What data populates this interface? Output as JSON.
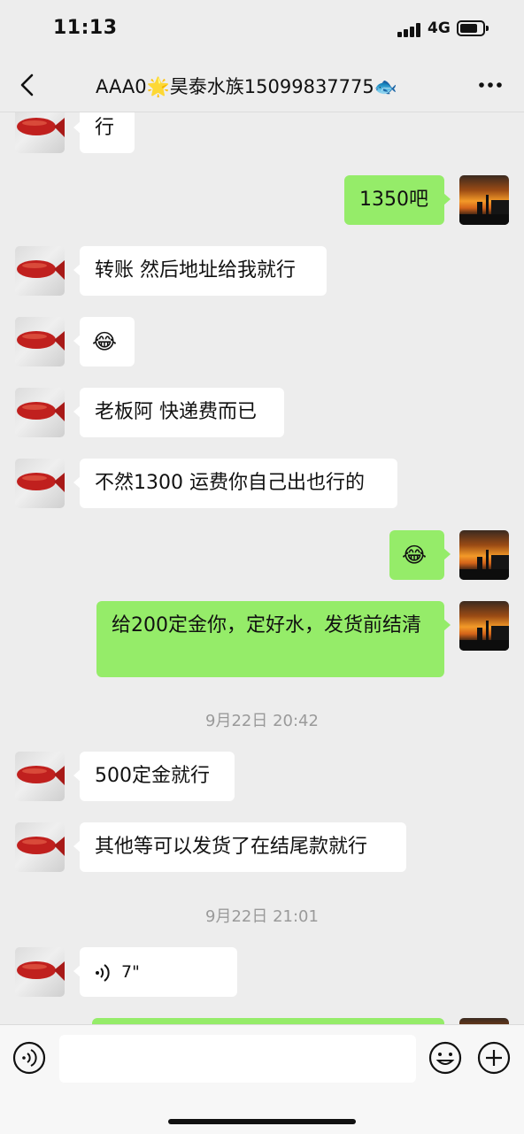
{
  "status": {
    "time": "11:13",
    "network": "4G"
  },
  "nav": {
    "title": "AAA0🌟昊泰水族15099837775🐟"
  },
  "messages": [
    {
      "side": "in",
      "text": "行"
    },
    {
      "side": "out",
      "text": "1350吧"
    },
    {
      "side": "in",
      "text": "转账 然后地址给我就行"
    },
    {
      "side": "in",
      "emoji": "😂"
    },
    {
      "side": "in",
      "text": "老板阿 快递费而已"
    },
    {
      "side": "in",
      "text": "不然1300 运费你自己出也行的"
    },
    {
      "side": "out",
      "emoji": "😂"
    },
    {
      "side": "out",
      "text": "给200定金你，定好水，发货前结清"
    },
    {
      "side": "in",
      "text": "500定金就行"
    },
    {
      "side": "in",
      "text": "其他等可以发货了在结尾款就行"
    },
    {
      "side": "in",
      "voice_duration": "7\""
    },
    {
      "side": "out",
      "text": ""
    }
  ],
  "timestamps": [
    "9月22日 20:42",
    "9月22日 21:01"
  ],
  "icons": {
    "back": "chevron-left-icon",
    "more": "ellipsis-icon",
    "voice_toggle": "voice-wave-icon",
    "emoji": "smiley-icon",
    "plus": "plus-circle-icon"
  },
  "colors": {
    "outgoing_bubble": "#95ec69",
    "incoming_bubble": "#ffffff",
    "background": "#ededed"
  }
}
